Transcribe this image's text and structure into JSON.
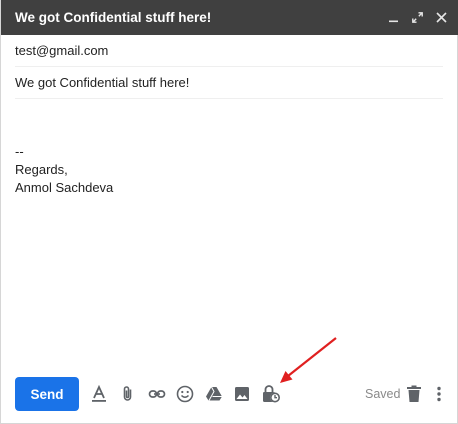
{
  "window": {
    "title": "We got Confidential stuff here!",
    "controls": [
      "minimize-icon",
      "expand-icon",
      "close-icon"
    ]
  },
  "compose": {
    "to": "test@gmail.com",
    "subject": "We got Confidential stuff here!",
    "body_lines": [
      "--",
      "Regards,",
      "Anmol Sachdeva"
    ]
  },
  "toolbar": {
    "send_label": "Send",
    "saved_label": "Saved",
    "tools": [
      "formatting-icon",
      "attach-icon",
      "link-icon",
      "emoji-icon",
      "drive-icon",
      "photo-icon",
      "confidential-mode-icon"
    ],
    "accent": "#1a73e8"
  },
  "annotation": {
    "arrow_color": "#e02020",
    "points_to": "confidential-mode-icon"
  }
}
